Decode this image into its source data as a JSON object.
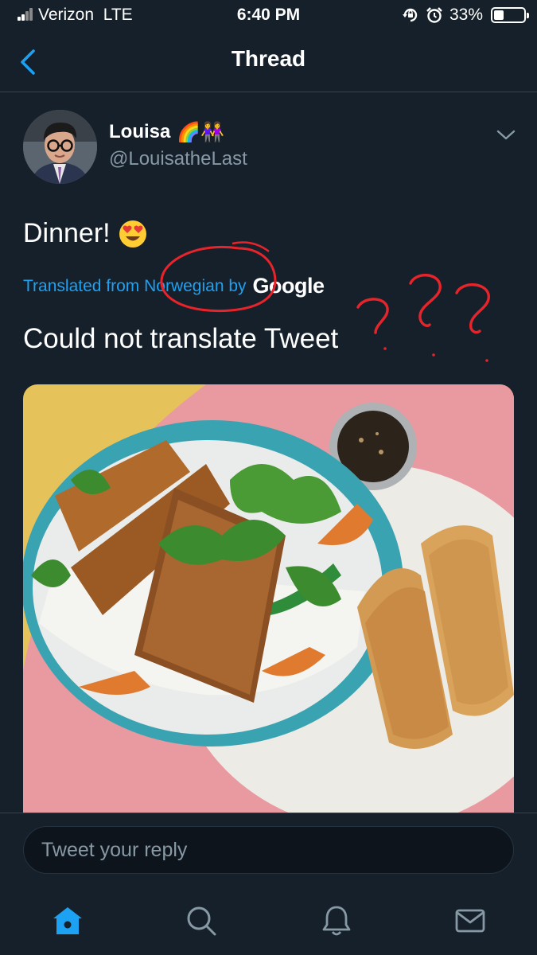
{
  "status_bar": {
    "carrier": "Verizon",
    "network": "LTE",
    "time": "6:40 PM",
    "battery": "33%",
    "battery_level": 0.33,
    "icons": [
      "signal-icon",
      "rotation-lock-icon",
      "alarm-icon",
      "battery-icon"
    ]
  },
  "nav": {
    "title": "Thread",
    "back_icon": "chevron-left-icon"
  },
  "tweet": {
    "display_name": "Louisa",
    "name_emojis": "🌈👭",
    "handle": "@LouisatheLast",
    "text": "Dinner!",
    "text_emoji": "😍",
    "translated_prefix": "Translated from ",
    "translated_language": "Norwegian",
    "translated_by": " by",
    "translated_provider": "Google",
    "translation_text": "Could not translate Tweet",
    "annotation_color": "#e8242b"
  },
  "reply": {
    "placeholder": "Tweet your reply"
  },
  "tab_bar": {
    "tabs": [
      "home-icon",
      "search-icon",
      "notifications-icon",
      "messages-icon"
    ],
    "active_color": "#1da1f2",
    "inactive_color": "#8899a6"
  },
  "colors": {
    "background": "#15202b",
    "accent": "#1da1f2",
    "secondary_text": "#8899a6"
  }
}
